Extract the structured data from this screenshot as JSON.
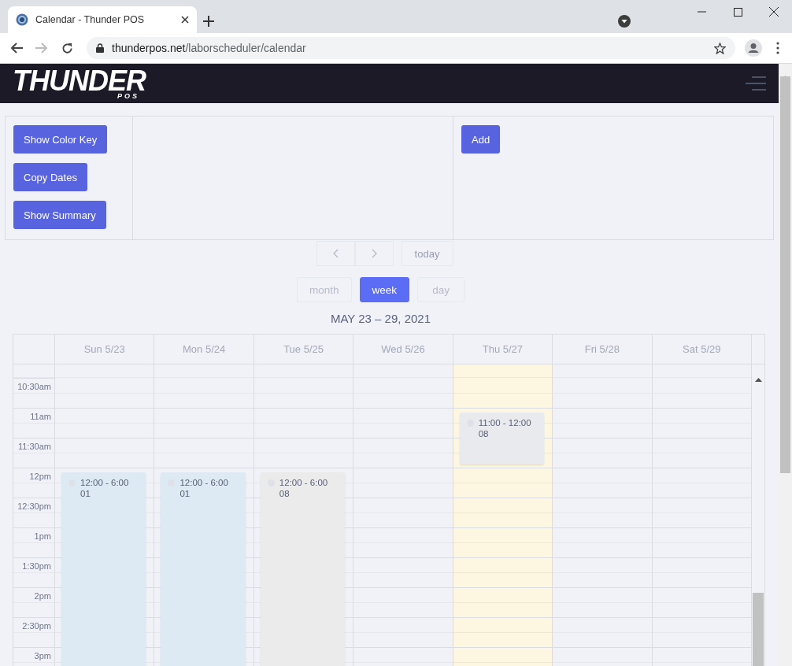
{
  "browser": {
    "tab_title": "Calendar - Thunder POS",
    "url_host": "thunderpos.net",
    "url_path": "/laborscheduler/calendar"
  },
  "header": {
    "logo_main": "THUNDER",
    "logo_sub": "POS"
  },
  "toolbar": {
    "left_buttons": [
      "Show Color Key",
      "Copy Dates",
      "Show Summary"
    ],
    "right_buttons": [
      "Add"
    ]
  },
  "navigation": {
    "today": {
      "label": "today",
      "disabled": true
    }
  },
  "views": [
    {
      "label": "month",
      "selected": false
    },
    {
      "label": "week",
      "selected": true
    },
    {
      "label": "day",
      "selected": false
    }
  ],
  "range_title": "MAY 23 – 29, 2021",
  "time_slots": [
    "10:30am",
    "11am",
    "11:30am",
    "12pm",
    "12:30pm",
    "1pm",
    "1:30pm",
    "2pm",
    "2:30pm",
    "3pm"
  ],
  "days": [
    {
      "label": "Sun 5/23",
      "today": false,
      "events": [
        {
          "time": "12:00 - 6:00",
          "code": "01",
          "color": "#dde9f3"
        }
      ]
    },
    {
      "label": "Mon 5/24",
      "today": false,
      "events": [
        {
          "time": "12:00 - 6:00",
          "code": "01",
          "color": "#dde9f3"
        }
      ]
    },
    {
      "label": "Tue 5/25",
      "today": false,
      "events": [
        {
          "time": "12:00 - 6:00",
          "code": "08",
          "color": "#ebebeb"
        }
      ]
    },
    {
      "label": "Wed 5/26",
      "today": false
    },
    {
      "label": "Thu 5/27",
      "today": true,
      "events": [
        {
          "time": "11:00 - 12:00",
          "code": "08",
          "color": "#e9eaed"
        }
      ]
    },
    {
      "label": "Fri 5/28",
      "today": false
    },
    {
      "label": "Sat 5/29",
      "today": false
    }
  ]
}
